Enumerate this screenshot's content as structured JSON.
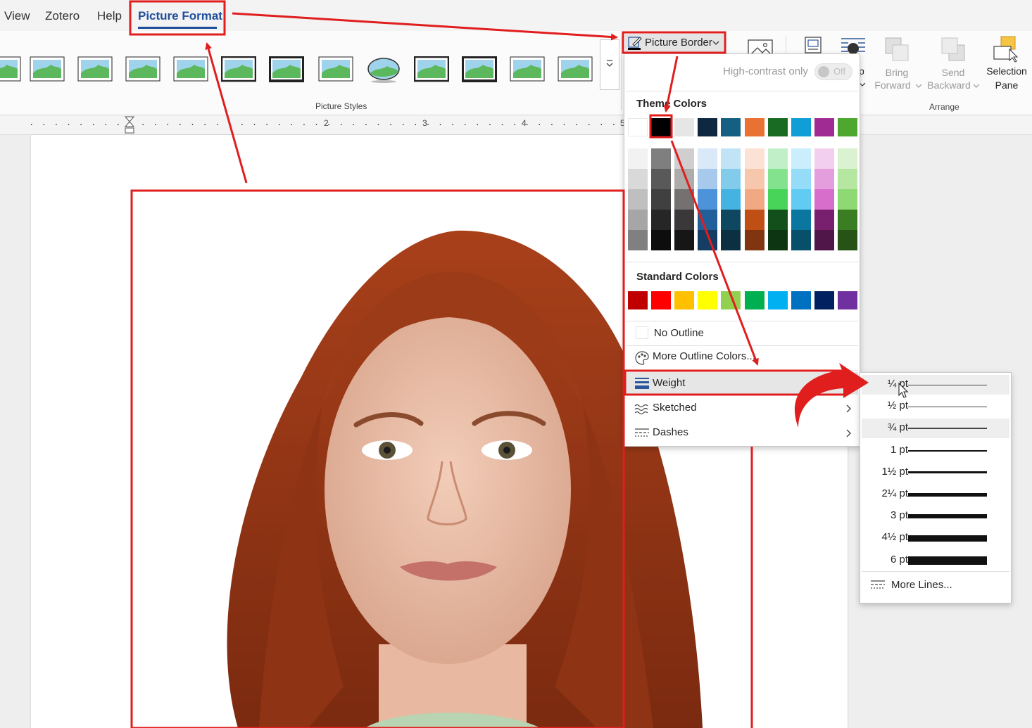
{
  "menubar": {
    "tabs": [
      "View",
      "Zotero",
      "Help",
      "Picture Format"
    ],
    "active_tab": "Picture Format"
  },
  "ribbon": {
    "picture_styles_label": "Picture Styles",
    "picture_border_label": "Picture Border",
    "bring_forward_label": "Bring Forward",
    "bring_forward_line1": "Bring",
    "bring_forward_line2": "Forward",
    "send_backward_line1": "Send",
    "send_backward_line2": "Backward",
    "selection_pane_line1": "Selection",
    "selection_pane_line2": "Pane",
    "arrange_label": "Arrange",
    "partial_button_label": "p"
  },
  "ruler": {
    "numbers": [
      "2",
      "3",
      "4",
      "5"
    ]
  },
  "picture_border_menu": {
    "high_contrast_label": "High-contrast only",
    "toggle_state": "Off",
    "theme_colors_title": "Theme Colors",
    "theme_colors_top": [
      "#ffffff",
      "#000000",
      "#e7e6e6",
      "#0e2841",
      "#156082",
      "#e97132",
      "#196b24",
      "#0f9ed5",
      "#a02b93",
      "#4ea72e"
    ],
    "theme_colors_shades": [
      [
        "#f2f2f2",
        "#d9d9d9",
        "#bfbfbf",
        "#a6a6a6",
        "#808080"
      ],
      [
        "#7f7f7f",
        "#595959",
        "#404040",
        "#262626",
        "#0d0d0d"
      ],
      [
        "#d0cece",
        "#aeabab",
        "#757171",
        "#3a3838",
        "#161616"
      ],
      [
        "#dae9f8",
        "#a6c9ec",
        "#4d93d9",
        "#215f9a",
        "#153d64"
      ],
      [
        "#c0e4f5",
        "#83cbeb",
        "#44b3e1",
        "#0f4761",
        "#0b3041"
      ],
      [
        "#fbe2d5",
        "#f7c7ac",
        "#f1a983",
        "#c04f15",
        "#803510"
      ],
      [
        "#c1f0c8",
        "#83e28e",
        "#47d459",
        "#124f1a",
        "#0d3512"
      ],
      [
        "#caeefb",
        "#94dcf8",
        "#61cbf3",
        "#0b76a0",
        "#074f6a"
      ],
      [
        "#f2cfee",
        "#e49edd",
        "#d86ecc",
        "#78206e",
        "#501549"
      ],
      [
        "#daf2d0",
        "#b5e6a2",
        "#8ed973",
        "#3b7d23",
        "#275317"
      ]
    ],
    "standard_colors_title": "Standard Colors",
    "standard_colors": [
      "#c00000",
      "#ff0000",
      "#ffc000",
      "#ffff00",
      "#92d050",
      "#00b050",
      "#00b0f0",
      "#0070c0",
      "#002060",
      "#7030a0"
    ],
    "no_outline_label": "No Outline",
    "more_colors_label": "More Outline Colors...",
    "weight_label": "Weight",
    "sketched_label": "Sketched",
    "dashes_label": "Dashes"
  },
  "weight_menu": {
    "items": [
      {
        "label": "¼ pt",
        "weight": 0.25
      },
      {
        "label": "½ pt",
        "weight": 0.5
      },
      {
        "label": "¾ pt",
        "weight": 0.75
      },
      {
        "label": "1 pt",
        "weight": 1
      },
      {
        "label": "1½ pt",
        "weight": 1.5
      },
      {
        "label": "2¼ pt",
        "weight": 2.25
      },
      {
        "label": "3 pt",
        "weight": 3
      },
      {
        "label": "4½ pt",
        "weight": 4.5
      },
      {
        "label": "6 pt",
        "weight": 6
      }
    ],
    "more_lines_label": "More Lines..."
  },
  "colors": {
    "annotation_red": "#e01e1e",
    "accent_blue": "#1f4e9c",
    "hair": "#b13d17"
  }
}
